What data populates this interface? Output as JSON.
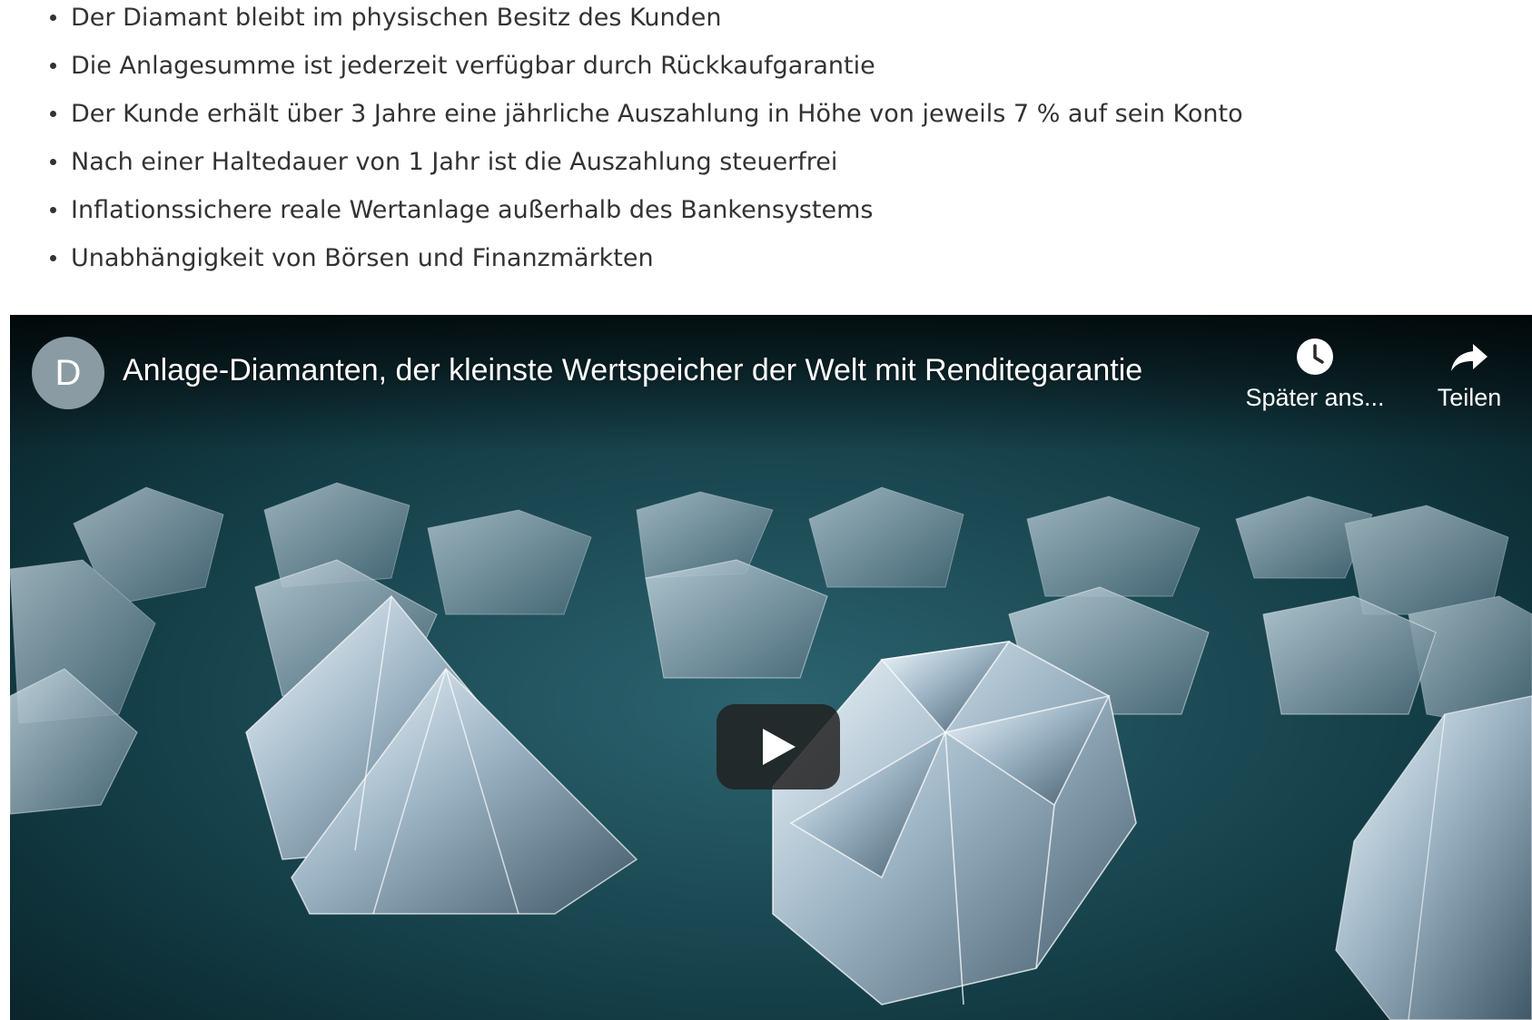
{
  "benefits": [
    "Der Diamant bleibt im physischen Besitz des Kunden",
    "Die Anlagesumme ist jederzeit verfügbar durch Rückkaufgarantie",
    "Der Kunde erhält über 3 Jahre eine jährliche Auszahlung in Höhe von jeweils 7 % auf sein Konto",
    "Nach einer Haltedauer von 1 Jahr ist die Auszahlung steuerfrei",
    "Inflationssichere reale Wertanlage außerhalb des Bankensystems",
    "Unabhängigkeit von Börsen und Finanzmärkten"
  ],
  "video": {
    "channel_initial": "D",
    "title": "Anlage-Diamanten, der kleinste Wertspeicher der Welt mit Renditegarantie",
    "watch_later_label": "Später ans...",
    "share_label": "Teilen",
    "icons": {
      "watch_later": "clock-icon",
      "share": "share-arrow-icon",
      "play": "play-icon"
    },
    "colors": {
      "background": "#0b2a30",
      "play_button": "#212121"
    }
  }
}
